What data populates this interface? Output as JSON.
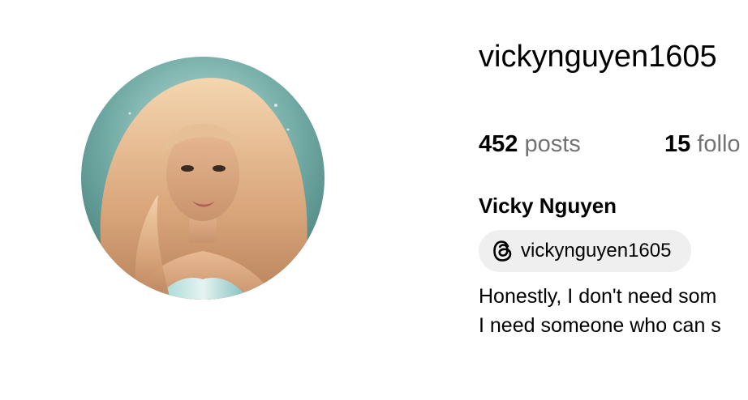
{
  "profile": {
    "username": "vickynguyen1605",
    "avatar_alt": "profile-photo",
    "stats": {
      "posts_count": "452",
      "posts_label": "posts",
      "followers_count": "15",
      "followers_label": "follo"
    },
    "full_name": "Vicky Nguyen",
    "threads": {
      "icon": "threads-icon",
      "handle": "vickynguyen1605"
    },
    "bio_lines": [
      "Honestly, I don't need som",
      "I need someone who can s"
    ]
  },
  "colors": {
    "background": "#ffffff",
    "text_primary": "#000000",
    "text_secondary": "#737373",
    "chip_background": "#efefef"
  }
}
